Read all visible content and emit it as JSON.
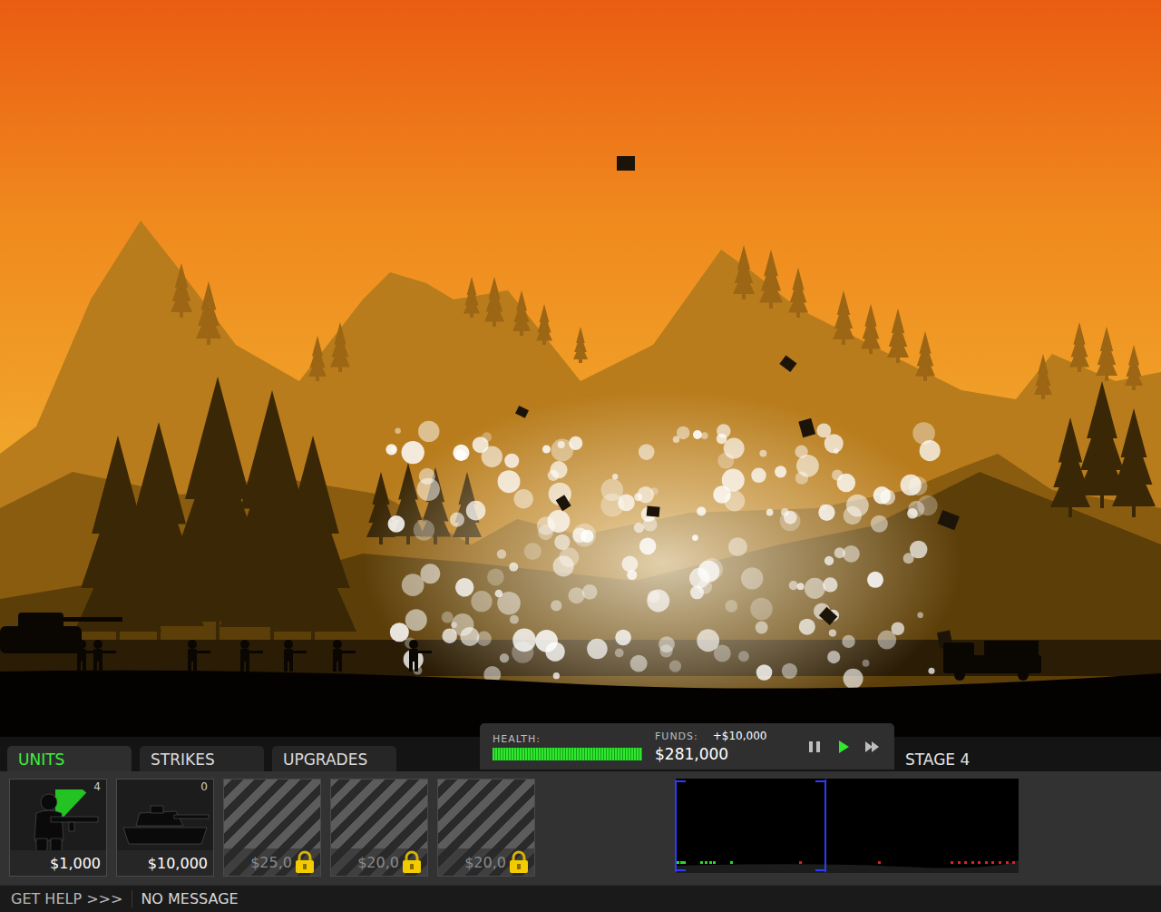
{
  "tabs": [
    {
      "label": "UNITS",
      "selected": true
    },
    {
      "label": "STRIKES",
      "selected": false
    },
    {
      "label": "UPGRADES",
      "selected": false
    }
  ],
  "status": {
    "health_label": "HEALTH:",
    "health_level": 1.0,
    "funds_label": "FUNDS:",
    "funds_delta": "+$10,000",
    "funds": "$281,000"
  },
  "controls": [
    {
      "kind": "pause",
      "selected": false
    },
    {
      "kind": "play",
      "selected": true
    },
    {
      "kind": "fast-forward",
      "selected": false
    }
  ],
  "stage": "STAGE 4",
  "units": [
    {
      "kind": "infantry",
      "price": "$1,000",
      "count": "4",
      "locked": false,
      "level": 0.12
    },
    {
      "kind": "tank",
      "price": "$10,000",
      "count": "0",
      "locked": false,
      "level": 0
    },
    {
      "kind": "unknown",
      "price": "$25,0",
      "count": "",
      "locked": true,
      "level": 0
    },
    {
      "kind": "unknown",
      "price": "$20,0",
      "count": "",
      "locked": true,
      "level": 0
    },
    {
      "kind": "unknown",
      "price": "$20,0",
      "count": "",
      "locked": true,
      "level": 0
    }
  ],
  "minimap": {
    "viewport_start": 0.0,
    "viewport_end": 0.44,
    "friendly": [
      0.005,
      0.015,
      0.025,
      0.075,
      0.088,
      0.1,
      0.112,
      0.16
    ],
    "enemy": [
      0.37,
      0.6,
      0.81,
      0.83,
      0.85,
      0.87,
      0.89,
      0.91,
      0.93,
      0.95,
      0.97,
      0.99
    ]
  },
  "footer": {
    "help": "GET HELP >>>",
    "message": "NO MESSAGE"
  }
}
